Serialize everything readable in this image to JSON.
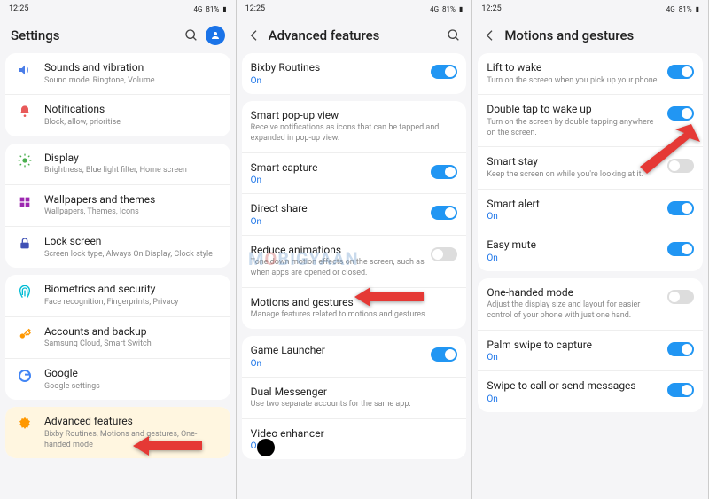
{
  "status": {
    "time": "12:25",
    "battery": "81%",
    "net": "4G"
  },
  "panel1": {
    "title": "Settings",
    "groups": [
      [
        {
          "icon": "speaker",
          "color": "#4a7de8",
          "title": "Sounds and vibration",
          "sub": "Sound mode, Ringtone, Volume"
        },
        {
          "icon": "bell",
          "color": "#e85a5a",
          "title": "Notifications",
          "sub": "Block, allow, prioritise"
        }
      ],
      [
        {
          "icon": "sun",
          "color": "#4caf50",
          "title": "Display",
          "sub": "Brightness, Blue light filter, Home screen"
        },
        {
          "icon": "palette",
          "color": "#9c27b0",
          "title": "Wallpapers and themes",
          "sub": "Wallpapers, Themes, Icons"
        },
        {
          "icon": "lock",
          "color": "#3f51b5",
          "title": "Lock screen",
          "sub": "Screen lock type, Always On Display, Clock style"
        }
      ],
      [
        {
          "icon": "finger",
          "color": "#00bcd4",
          "title": "Biometrics and security",
          "sub": "Face recognition, Fingerprints, Privacy"
        },
        {
          "icon": "key",
          "color": "#ff9800",
          "title": "Accounts and backup",
          "sub": "Samsung Cloud, Smart Switch"
        },
        {
          "icon": "google",
          "color": "#4285f4",
          "title": "Google",
          "sub": "Google settings"
        }
      ],
      [
        {
          "icon": "gear",
          "color": "#ff9800",
          "title": "Advanced features",
          "sub": "Bixby Routines, Motions and gestures, One-handed mode",
          "highlight": true
        }
      ]
    ]
  },
  "panel2": {
    "title": "Advanced features",
    "groups": [
      [
        {
          "title": "Bixby Routines",
          "on": "On",
          "toggle": true
        }
      ],
      [
        {
          "title": "Smart pop-up view",
          "sub": "Receive notifications as icons that can be tapped and expanded in pop-up view."
        },
        {
          "title": "Smart capture",
          "on": "On",
          "toggle": true
        },
        {
          "title": "Direct share",
          "on": "On",
          "toggle": true
        },
        {
          "title": "Reduce animations",
          "sub": "Tone down motion effects on the screen, such as when apps are opened or closed.",
          "toggle": true,
          "off": true
        },
        {
          "title": "Motions and gestures",
          "sub": "Manage features related to motions and gestures."
        }
      ],
      [
        {
          "title": "Game Launcher",
          "on": "On",
          "toggle": true
        },
        {
          "title": "Dual Messenger",
          "sub": "Use two separate accounts for the same app."
        },
        {
          "title": "Video enhancer",
          "on": "On"
        }
      ]
    ]
  },
  "panel3": {
    "title": "Motions and gestures",
    "groups": [
      [
        {
          "title": "Lift to wake",
          "sub": "Turn on the screen when you pick up your phone.",
          "toggle": true
        },
        {
          "title": "Double tap to wake up",
          "sub": "Turn on the screen by double tapping anywhere on the screen.",
          "toggle": true
        },
        {
          "title": "Smart stay",
          "sub": "Keep the screen on while you're looking at it.",
          "toggle": true,
          "off": true
        },
        {
          "title": "Smart alert",
          "on": "On",
          "toggle": true
        },
        {
          "title": "Easy mute",
          "on": "On",
          "toggle": true
        }
      ],
      [
        {
          "title": "One-handed mode",
          "sub": "Adjust the display size and layout for easier control of your phone with just one hand.",
          "toggle": true,
          "off": true
        },
        {
          "title": "Palm swipe to capture",
          "on": "On",
          "toggle": true
        },
        {
          "title": "Swipe to call or send messages",
          "on": "On",
          "toggle": true
        }
      ]
    ]
  },
  "watermark": "MOBIGYAAN"
}
